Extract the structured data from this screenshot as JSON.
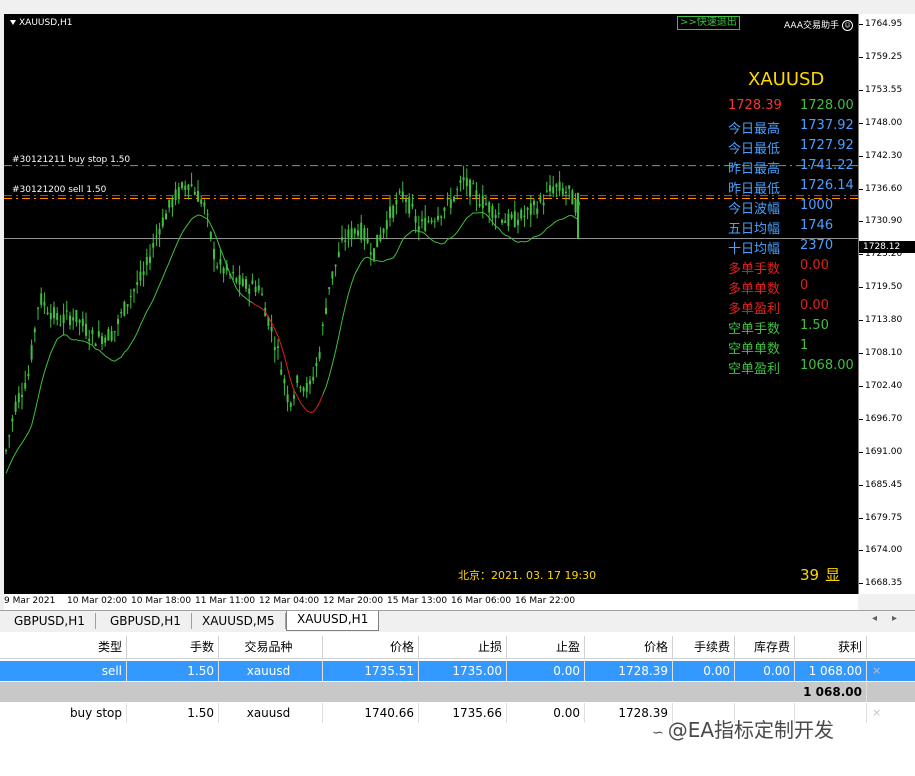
{
  "chart": {
    "symbol_label": "XAUUSD,H1",
    "quick_exit": ">>快速退出",
    "ea_label": "AAA交易助手",
    "orders": [
      "#30121211 buy stop 1.50",
      "#30121200 sell 1.50"
    ],
    "current_price_label": "1728.12",
    "y_ticks": [
      "1764.95",
      "1759.25",
      "1753.55",
      "1748.00",
      "1742.30",
      "1736.60",
      "1730.90",
      "1725.20",
      "1719.50",
      "1713.80",
      "1708.10",
      "1702.40",
      "1696.70",
      "1691.00",
      "1685.45",
      "1679.75",
      "1674.00",
      "1668.35"
    ],
    "x_ticks": [
      "9 Mar 2021",
      "10 Mar 02:00",
      "10 Mar 18:00",
      "11 Mar 11:00",
      "12 Mar 04:00",
      "12 Mar 20:00",
      "15 Mar 13:00",
      "16 Mar 06:00",
      "16 Mar 22:00"
    ],
    "beijing_time": "北京：2021. 03. 17  19:30",
    "countdown_num": "39",
    "countdown_label": "显"
  },
  "panel": {
    "title": "XAUUSD",
    "rows": [
      {
        "label": "1728.39",
        "value": "1728.00",
        "label_color": "#ff3030",
        "value_color": "#40c040"
      },
      {
        "label": "今日最高",
        "value": "1737.92",
        "label_color": "#4aa0ff",
        "value_color": "#4aa0ff"
      },
      {
        "label": "今日最低",
        "value": "1727.92",
        "label_color": "#4aa0ff",
        "value_color": "#4aa0ff"
      },
      {
        "label": "昨日最高",
        "value": "1741.22",
        "label_color": "#4aa0ff",
        "value_color": "#4aa0ff"
      },
      {
        "label": "昨日最低",
        "value": "1726.14",
        "label_color": "#4aa0ff",
        "value_color": "#4aa0ff"
      },
      {
        "label": "今日波幅",
        "value": "1000",
        "label_color": "#4aa0ff",
        "value_color": "#4aa0ff"
      },
      {
        "label": "五日均幅",
        "value": "1746",
        "label_color": "#4aa0ff",
        "value_color": "#4aa0ff"
      },
      {
        "label": "十日均幅",
        "value": "2370",
        "label_color": "#4aa0ff",
        "value_color": "#4aa0ff"
      },
      {
        "label": "多单手数",
        "value": "0.00",
        "label_color": "#e02020",
        "value_color": "#e02020"
      },
      {
        "label": "多单单数",
        "value": "0",
        "label_color": "#e02020",
        "value_color": "#e02020"
      },
      {
        "label": "多单盈利",
        "value": "0.00",
        "label_color": "#e02020",
        "value_color": "#e02020"
      },
      {
        "label": "空单手数",
        "value": "1.50",
        "label_color": "#40c040",
        "value_color": "#40c040"
      },
      {
        "label": "空单单数",
        "value": "1",
        "label_color": "#40c040",
        "value_color": "#40c040"
      },
      {
        "label": "空单盈利",
        "value": "1068.00",
        "label_color": "#40c040",
        "value_color": "#40c040"
      }
    ]
  },
  "tabs": [
    "GBPUSD,H1",
    "GBPUSD,H1",
    "XAUUSD,M5",
    "XAUUSD,H1"
  ],
  "table": {
    "headers": [
      "类型",
      "手数",
      "交易品种",
      "价格",
      "止损",
      "止盈",
      "价格",
      "手续费",
      "库存费",
      "获利"
    ],
    "rows": [
      [
        "sell",
        "1.50",
        "xauusd",
        "1735.51",
        "1735.00",
        "0.00",
        "1728.39",
        "0.00",
        "0.00",
        "1 068.00"
      ],
      [
        "buy stop",
        "1.50",
        "xauusd",
        "1740.66",
        "1735.66",
        "0.00",
        "1728.39",
        "",
        "",
        ""
      ]
    ],
    "total": "1 068.00"
  },
  "watermark": "@EA指标定制开发",
  "colors": {
    "background": "#000000",
    "candle": "#40c040",
    "ma_up": "#40c040",
    "ma_down": "#e02020",
    "selected_row": "#3399ff",
    "accent": "#ffd700"
  }
}
